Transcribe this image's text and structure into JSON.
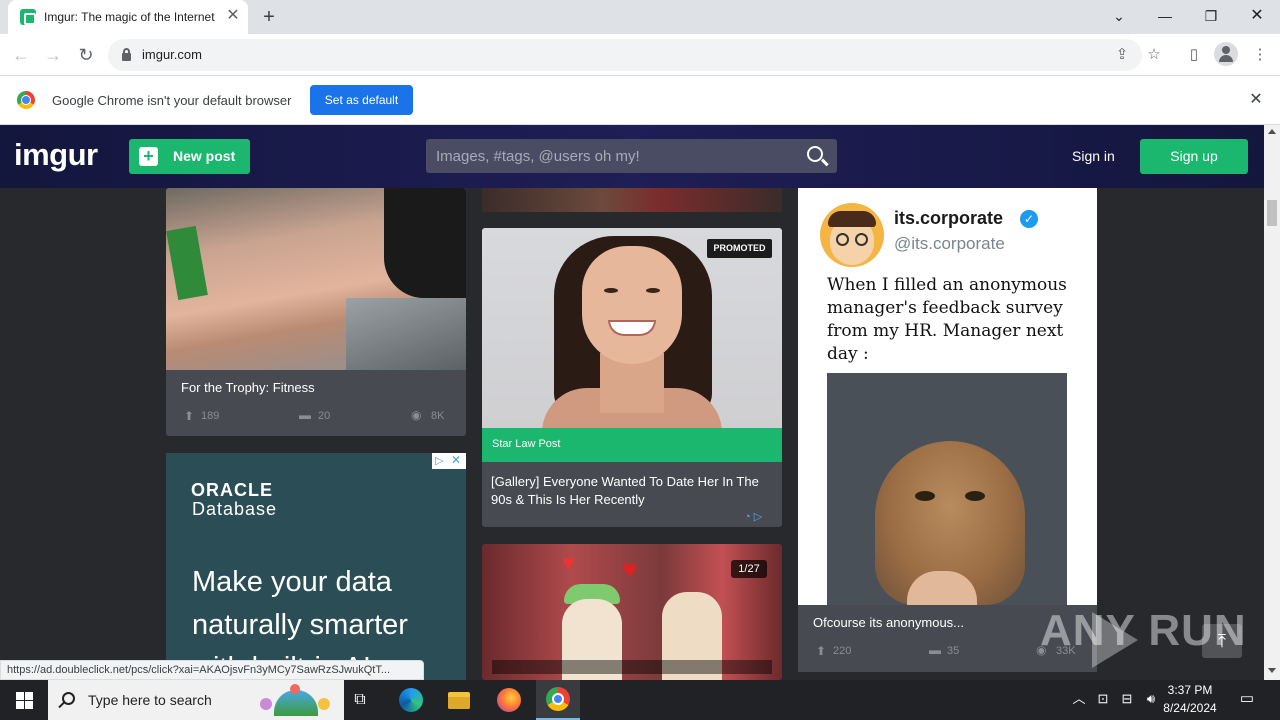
{
  "browser": {
    "tab_title": "Imgur: The magic of the Internet",
    "url": "imgur.com",
    "status_url": "https://ad.doubleclick.net/pcs/click?xai=AKAOjsvFn3yMCy7SawRzSJwukQtT..."
  },
  "infobar": {
    "message": "Google Chrome isn't your default browser",
    "button": "Set as default"
  },
  "imgur_header": {
    "logo": "imgur",
    "new_post": "New post",
    "search_placeholder": "Images, #tags, @users oh my!",
    "sign_in": "Sign in",
    "sign_up": "Sign up"
  },
  "feed": {
    "fitness": {
      "title": "For the Trophy: Fitness",
      "upvotes": "189",
      "comments": "20",
      "views": "8K"
    },
    "oracle_ad": {
      "brand": "ORACLE",
      "product": "Database",
      "headline": "Make your data naturally smarter with built-in AI"
    },
    "promoted": {
      "badge": "PROMOTED",
      "sponsor": "Star Law Post",
      "title": "[Gallery] Everyone Wanted To Date Her In The 90s & This Is Her Recently"
    },
    "valentine": {
      "counter": "1/27"
    },
    "tweet": {
      "name": "its.corporate",
      "handle": "@its.corporate",
      "text": "When I filled an anonymous manager's feedback survey from my HR. Manager next day :",
      "caption": "Ofcourse its anonymous...",
      "upvotes": "220",
      "comments": "35",
      "views": "33K"
    }
  },
  "watermark": {
    "text": "ANY RUN"
  },
  "taskbar": {
    "search_text": "Type here to search",
    "time": "3:37 PM",
    "date": "8/24/2024"
  }
}
